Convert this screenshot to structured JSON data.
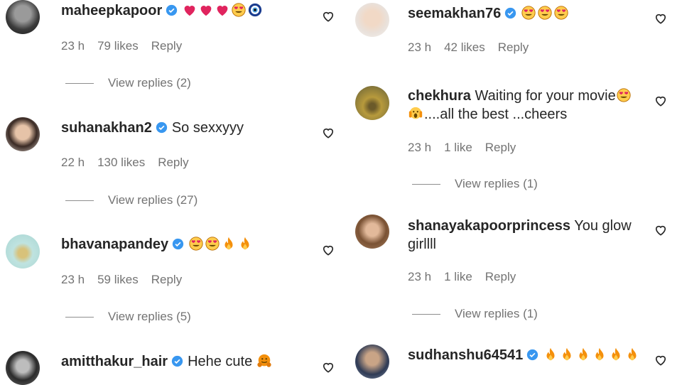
{
  "comments_left": [
    {
      "username": "maheepkapoor",
      "verified": true,
      "text": "",
      "emojis": [
        "heart",
        "heart",
        "heart",
        "heart-eyes",
        "nazar"
      ],
      "time": "23 h",
      "likes": "79 likes",
      "reply": "Reply",
      "view_replies": "View replies (2)"
    },
    {
      "username": "suhanakhan2",
      "verified": true,
      "text": "So sexxyyy",
      "emojis": [],
      "time": "22 h",
      "likes": "130 likes",
      "reply": "Reply",
      "view_replies": "View replies (27)"
    },
    {
      "username": "bhavanapandey",
      "verified": true,
      "text": "",
      "emojis": [
        "heart-eyes",
        "heart-eyes",
        "fire",
        "fire"
      ],
      "time": "23 h",
      "likes": "59 likes",
      "reply": "Reply",
      "view_replies": "View replies (5)"
    },
    {
      "username": "amitthakur_hair",
      "verified": true,
      "text": "Hehe cute",
      "emojis": [
        "hug"
      ],
      "time": "",
      "likes": "",
      "reply": "",
      "view_replies": ""
    }
  ],
  "comments_right": [
    {
      "username": "seemakhan76",
      "verified": true,
      "text": "",
      "emojis": [
        "heart-eyes",
        "heart-eyes",
        "heart-eyes"
      ],
      "time": "23 h",
      "likes": "42 likes",
      "reply": "Reply",
      "view_replies": ""
    },
    {
      "username": "chekhura",
      "verified": false,
      "text": "Waiting for your movie",
      "text2": "....all the best ...cheers",
      "emojis": [
        "heart-eyes"
      ],
      "time": "23 h",
      "likes": "1 like",
      "reply": "Reply",
      "view_replies": "View replies (1)"
    },
    {
      "username": "shanayakapoorprincess",
      "verified": false,
      "text": "You glow",
      "text2": "girllll",
      "emojis": [],
      "time": "23 h",
      "likes": "1 like",
      "reply": "Reply",
      "view_replies": "View replies (1)"
    },
    {
      "username": "sudhanshu64541",
      "verified": true,
      "text": "",
      "emojis": [
        "fire",
        "fire",
        "fire",
        "fire",
        "fire",
        "fire"
      ],
      "time": "",
      "likes": "",
      "reply": "",
      "view_replies": ""
    }
  ],
  "colors": {
    "verified": "#3897f0",
    "meta": "#737373",
    "text": "#262626"
  }
}
